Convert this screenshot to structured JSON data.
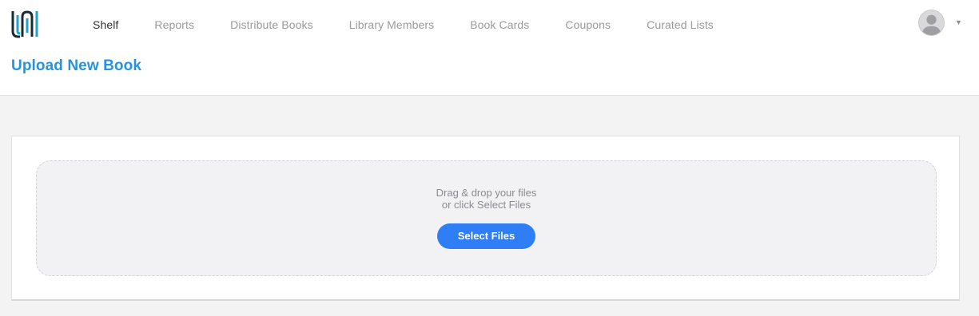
{
  "header": {
    "logo": "library-logo-icon",
    "nav": [
      {
        "label": "Shelf",
        "active": true
      },
      {
        "label": "Reports"
      },
      {
        "label": "Distribute Books"
      },
      {
        "label": "Library Members"
      },
      {
        "label": "Book Cards"
      },
      {
        "label": "Coupons"
      },
      {
        "label": "Curated Lists"
      }
    ],
    "user_menu": {
      "avatar": "user-avatar-icon",
      "caret": "▼"
    },
    "page_title": "Upload New Book"
  },
  "upload": {
    "line1": "Drag & drop your files",
    "line2": "or click Select Files",
    "button_label": "Select Files"
  },
  "colors": {
    "accent": "#2f7ef5",
    "title": "#2594e0",
    "background": "#f3f3f4"
  }
}
